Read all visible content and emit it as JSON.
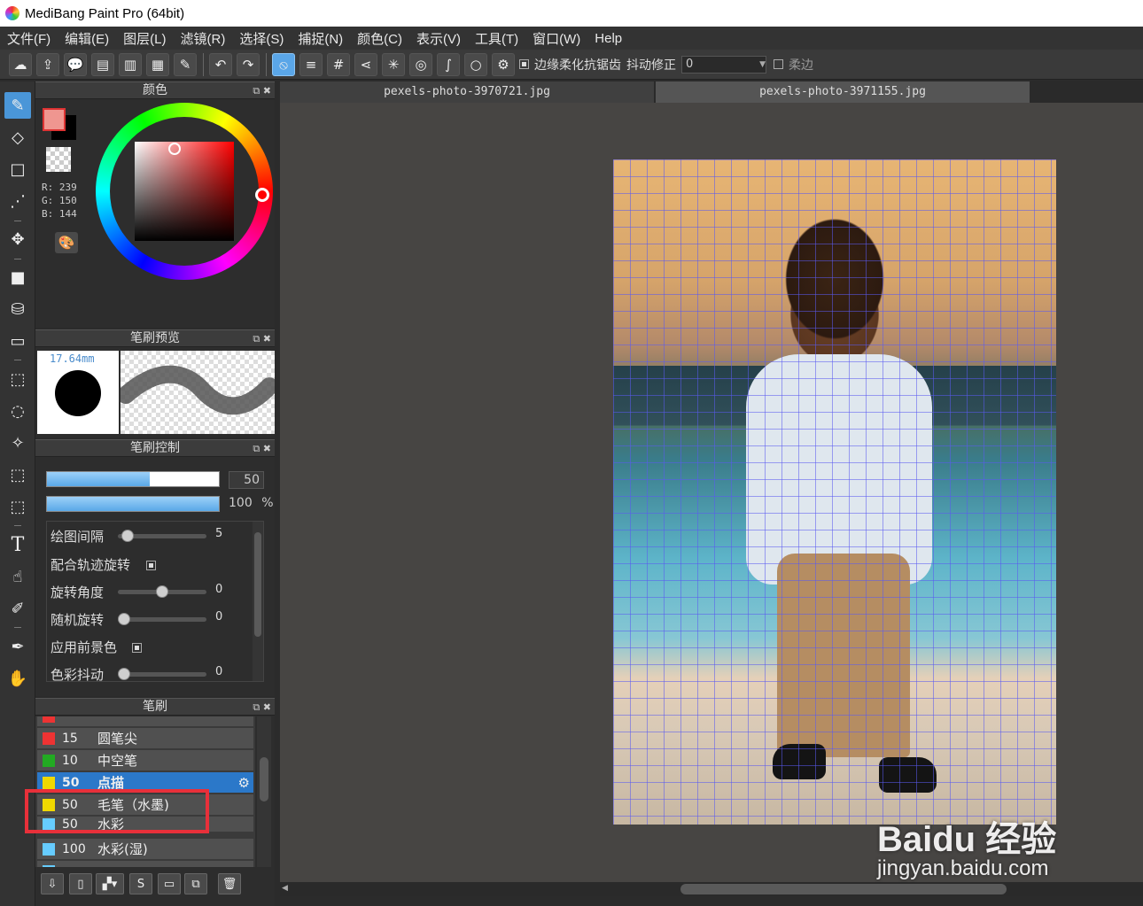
{
  "window": {
    "title": "MediBang Paint Pro (64bit)"
  },
  "menu": [
    "文件(F)",
    "编辑(E)",
    "图层(L)",
    "滤镜(R)",
    "选择(S)",
    "捕捉(N)",
    "颜色(C)",
    "表示(V)",
    "工具(T)",
    "窗口(W)",
    "Help"
  ],
  "toolbar": {
    "antialias_label": "边缘柔化抗锯齿",
    "stabilizer_label": "抖动修正",
    "stabilizer_value": "0",
    "soft_edge_label": "柔边"
  },
  "panels": {
    "color": {
      "title": "颜色",
      "r_label": "R: 239",
      "g_label": "G: 150",
      "b_label": "B: 144",
      "fg_color": "#ef9690",
      "bg_color": "#000000"
    },
    "brush_preview": {
      "title": "笔刷预览",
      "size": "17.64mm"
    },
    "brush_control": {
      "title": "笔刷控制",
      "size_value": "50",
      "opacity_value": "100",
      "opacity_unit": "%",
      "size_fraction": 0.6,
      "opacity_fraction": 1.0,
      "rows": [
        {
          "label": "绘图间隔",
          "value": "5",
          "fraction": 0.05
        },
        {
          "label": "配合轨迹旋转",
          "checked": true
        },
        {
          "label": "旋转角度",
          "value": "0",
          "fraction": 0.5
        },
        {
          "label": "随机旋转",
          "value": "0",
          "fraction": 0.0
        },
        {
          "label": "应用前景色",
          "checked": true
        },
        {
          "label": "色彩抖动",
          "value": "0",
          "fraction": 0.0
        }
      ]
    },
    "brush": {
      "title": "笔刷",
      "items": [
        {
          "num": "15",
          "name": "圆笔尖",
          "color": "#ee3333"
        },
        {
          "num": "10",
          "name": "中空笔",
          "color": "#22aa22"
        },
        {
          "num": "50",
          "name": "点描",
          "color": "#f0d800",
          "selected": true
        },
        {
          "num": "50",
          "name": "毛笔（水墨)",
          "color": "#f0d800"
        },
        {
          "num": "50",
          "name": "水彩",
          "color": "#66ccff"
        },
        {
          "num": "100",
          "name": "水彩(湿)",
          "color": "#66ccff"
        }
      ]
    }
  },
  "documents": {
    "tabs": [
      "pexels-photo-3970721.jpg",
      "pexels-photo-3971155.jpg"
    ]
  },
  "watermark": {
    "line1": "Baidu 经验",
    "line2": "jingyan.baidu.com"
  },
  "colors": {
    "accent": "#4a96d8",
    "highlight": "#e8303a",
    "grid": "#5a5af0"
  }
}
